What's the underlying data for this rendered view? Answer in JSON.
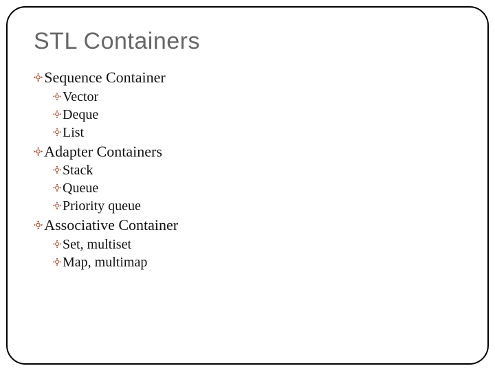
{
  "title": "STL Containers",
  "bullet_glyph": "༓",
  "sections": [
    {
      "heading": "Sequence Container",
      "items": [
        "Vector",
        "Deque",
        "List"
      ]
    },
    {
      "heading": "Adapter Containers",
      "items": [
        "Stack",
        "Queue",
        "Priority queue"
      ]
    },
    {
      "heading": "Associative Container",
      "items": [
        "Set, multiset",
        "Map, multimap"
      ]
    }
  ]
}
